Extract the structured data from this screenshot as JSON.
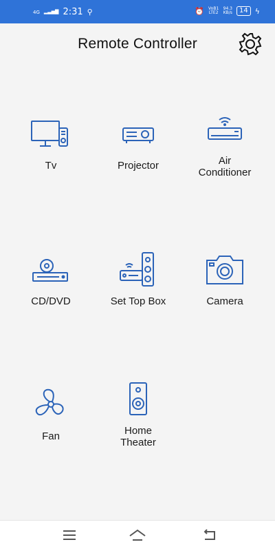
{
  "status_bar": {
    "network": "4G",
    "time": "2:31",
    "volte": "VoB1 LTE2",
    "speed_value": "94.3",
    "speed_unit": "KB/s",
    "battery": "14"
  },
  "header": {
    "title": "Remote Controller"
  },
  "devices": [
    {
      "label": "Tv",
      "icon": "tv-icon"
    },
    {
      "label": "Projector",
      "icon": "projector-icon"
    },
    {
      "label": "Air\nConditioner",
      "icon": "air-conditioner-icon"
    },
    {
      "label": "CD/DVD",
      "icon": "cd-dvd-icon"
    },
    {
      "label": "Set Top Box",
      "icon": "set-top-box-icon"
    },
    {
      "label": "Camera",
      "icon": "camera-icon"
    },
    {
      "label": "Fan",
      "icon": "fan-icon"
    },
    {
      "label": "Home\nTheater",
      "icon": "home-theater-icon"
    }
  ],
  "colors": {
    "status_bar": "#2f73d8",
    "icon_stroke": "#2b63b8",
    "background": "#f4f4f4"
  }
}
